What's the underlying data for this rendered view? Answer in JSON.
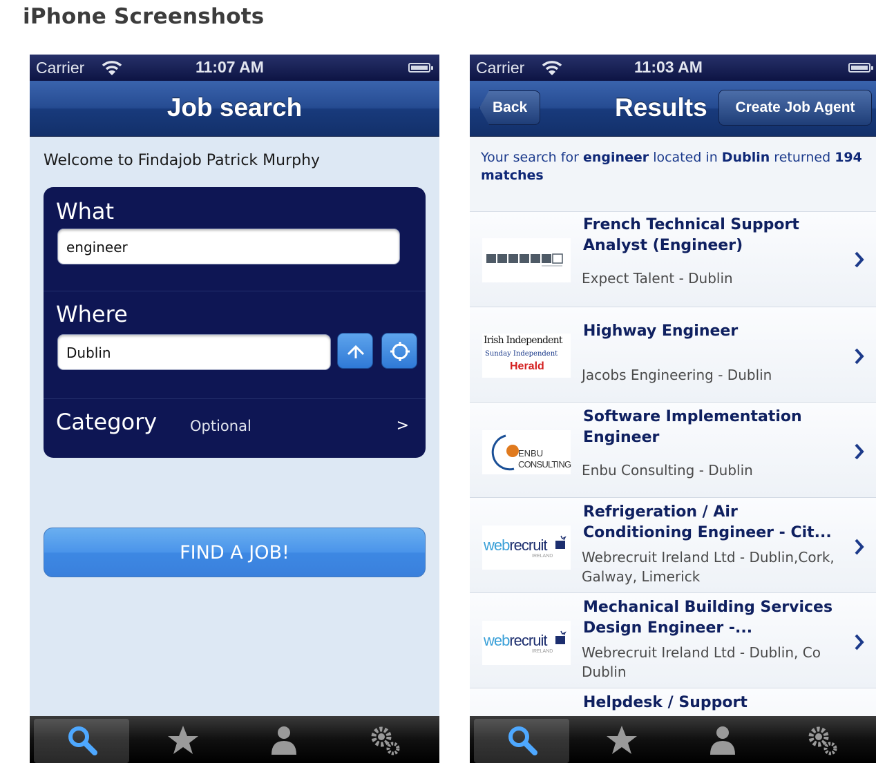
{
  "page_heading": "iPhone Screenshots",
  "left_screen": {
    "status": {
      "carrier": "Carrier",
      "time": "11:07 AM"
    },
    "nav_title": "Job search",
    "welcome": "Welcome to Findajob Patrick Murphy",
    "what_label": "What",
    "what_value": "engineer",
    "where_label": "Where",
    "where_value": "Dublin",
    "category_label": "Category",
    "category_value": "Optional",
    "category_chevron": ">",
    "find_button": "FIND A JOB!",
    "tabs": [
      {
        "icon": "search-icon",
        "selected": true
      },
      {
        "icon": "star-icon",
        "selected": false
      },
      {
        "icon": "person-icon",
        "selected": false
      },
      {
        "icon": "gears-icon",
        "selected": false
      }
    ]
  },
  "right_screen": {
    "status": {
      "carrier": "Carrier",
      "time": "11:03 AM"
    },
    "back_button": "Back",
    "nav_title": "Results",
    "create_agent_button": "Create Job Agent",
    "summary": {
      "prefix": "Your search for",
      "keyword": "engineer",
      "middle": "located in",
      "location": "Dublin",
      "suffix": "returned",
      "count": "194 matches"
    },
    "results": [
      {
        "title": "French Technical Support Analyst (Engineer)",
        "company": "Expect Talent - Dublin",
        "logo": "expect-talent-logo"
      },
      {
        "title": "Highway Engineer",
        "company": "Jacobs Engineering - Dublin",
        "logo": "irish-independent-logo",
        "logo_text": {
          "line1": "Irish Independent",
          "line2": "Sunday Independent",
          "line3": "Herald"
        }
      },
      {
        "title": "Software Implementation Engineer",
        "company": "Enbu Consulting - Dublin",
        "logo": "enbu-consulting-logo",
        "logo_text": {
          "line1": "ENBU",
          "line2": "CONSULTING"
        }
      },
      {
        "title": "Refrigeration / Air Conditioning Engineer - Cit...",
        "company": "Webrecruit Ireland Ltd - Dublin,Cork, Galway, Limerick",
        "logo": "webrecruit-logo",
        "logo_text": {
          "part1": "web",
          "part2": "recruit",
          "sub": "IRELAND"
        }
      },
      {
        "title": "Mechanical Building Services Design Engineer -...",
        "company": "Webrecruit Ireland Ltd - Dublin, Co Dublin",
        "logo": "webrecruit-logo",
        "logo_text": {
          "part1": "web",
          "part2": "recruit",
          "sub": "IRELAND"
        }
      },
      {
        "title": "Helpdesk / Support",
        "company": "",
        "logo": ""
      }
    ],
    "tabs": [
      {
        "icon": "search-icon",
        "selected": true
      },
      {
        "icon": "star-icon",
        "selected": false
      },
      {
        "icon": "person-icon",
        "selected": false
      },
      {
        "icon": "gears-icon",
        "selected": false
      }
    ]
  }
}
